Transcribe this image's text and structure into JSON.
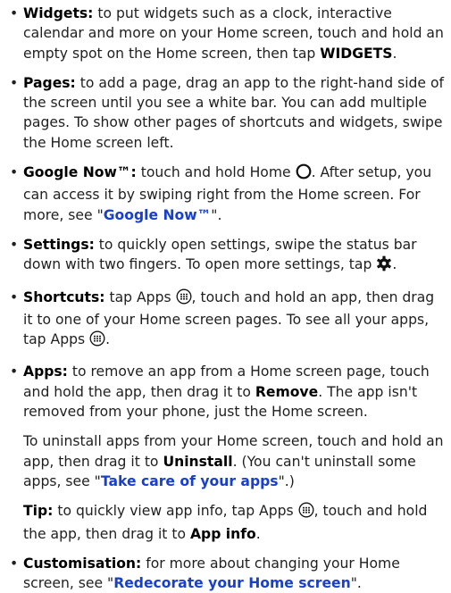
{
  "items": [
    {
      "term": "Widgets:",
      "t1": " to put widgets such as a clock, interactive calendar and more on your Home screen, touch and hold an empty spot on the Home screen, then tap ",
      "kw1": "WIDGETS",
      "t2": "."
    },
    {
      "term": "Pages:",
      "t1": " to add a page, drag an app to the right-hand side of the screen until you see a white bar. You can add multiple pages. To show other pages of shortcuts and widgets, swipe the Home screen left."
    },
    {
      "term": "Google Now™:",
      "t1": " touch and hold Home ",
      "t2": ". After setup, you can access it by swiping right from the Home screen. For more, see \"",
      "link": "Google Now™",
      "t3": "\"."
    },
    {
      "term": "Settings:",
      "t1": " to quickly open settings, swipe the status bar down with two fingers. To open more settings, tap ",
      "t2": "."
    },
    {
      "term": "Shortcuts:",
      "t1": " tap Apps ",
      "t2": ", touch and hold an app, then drag it to one of your Home screen pages. To see all your apps, tap Apps ",
      "t3": "."
    },
    {
      "term": "Apps:",
      "t1": " to remove an app from a Home screen page, touch and hold the app, then drag it to ",
      "kw1": "Remove",
      "t2": ". The app isn't removed from your phone, just the Home screen.",
      "para2": {
        "t1": "To uninstall apps from your Home screen, touch and hold an app, then drag it to ",
        "kw1": "Uninstall",
        "t2": ". (You can't uninstall some apps, see \"",
        "link": "Take care of your apps",
        "t3": "\".)"
      },
      "tip": {
        "term": "Tip:",
        "t1": " to quickly view app info, tap Apps ",
        "t2": ", touch and hold the app, then drag it to ",
        "kw1": "App info",
        "t3": "."
      }
    },
    {
      "term": "Customisation:",
      "t1": " for more about changing your Home screen, see \"",
      "link": "Redecorate your Home screen",
      "t2": "\"."
    }
  ],
  "icons": {
    "home": "home-circle-icon",
    "settings": "gear-icon",
    "apps": "apps-grid-icon"
  },
  "colors": {
    "text": "#1f1f1f",
    "link": "#1a40c8"
  }
}
